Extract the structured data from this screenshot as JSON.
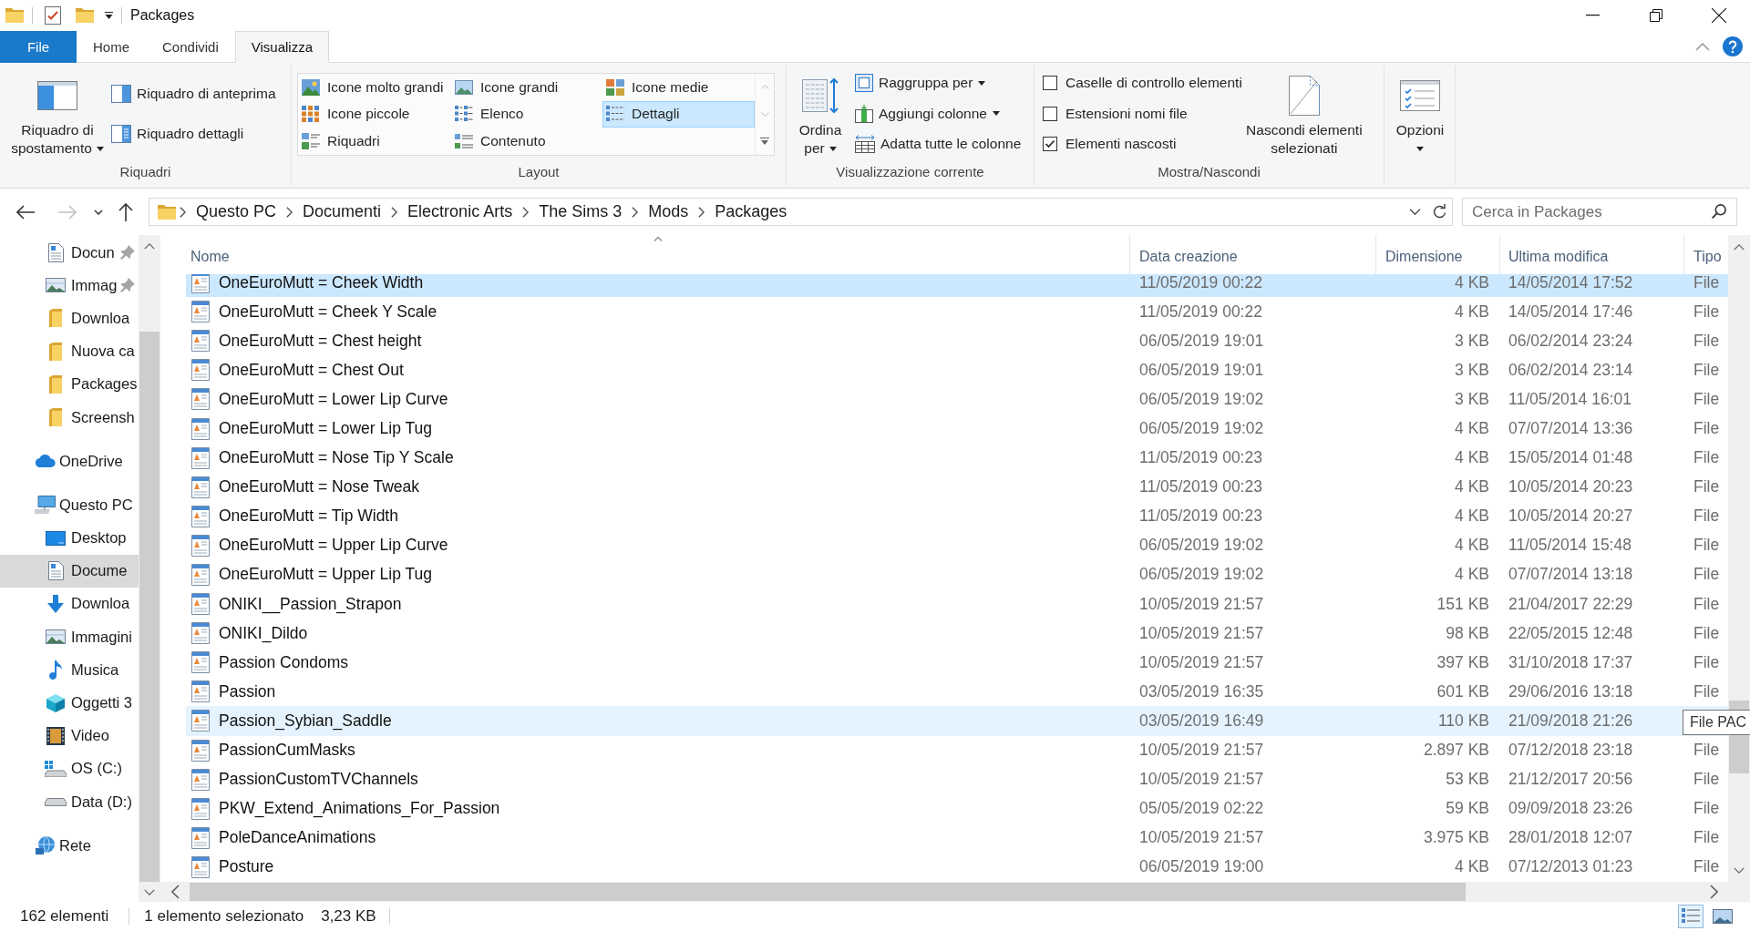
{
  "window": {
    "title": "Packages"
  },
  "ribbon": {
    "tabs": [
      {
        "label": "File",
        "kind": "file",
        "selected": false
      },
      {
        "label": "Home",
        "kind": "tab",
        "selected": false
      },
      {
        "label": "Condividi",
        "kind": "tab",
        "selected": false
      },
      {
        "label": "Visualizza",
        "kind": "tab",
        "selected": true
      }
    ],
    "groups": [
      {
        "kind": "panes",
        "label": "Riquadri",
        "large": {
          "lines": [
            "Riquadro di",
            "spostamento"
          ],
          "dropdown": true
        },
        "items": [
          {
            "kind": "preview",
            "label": "Riquadro di anteprima"
          },
          {
            "kind": "details",
            "label": "Riquadro dettagli"
          }
        ]
      },
      {
        "kind": "gallery",
        "label": "Layout",
        "items": [
          {
            "kind": "huge",
            "label": "Icone molto grandi",
            "selected": false
          },
          {
            "kind": "large",
            "label": "Icone grandi",
            "selected": false
          },
          {
            "kind": "medium",
            "label": "Icone medie",
            "selected": false
          },
          {
            "kind": "small",
            "label": "Icone piccole",
            "selected": false
          },
          {
            "kind": "list",
            "label": "Elenco",
            "selected": false
          },
          {
            "kind": "details",
            "label": "Dettagli",
            "selected": true
          },
          {
            "kind": "tiles",
            "label": "Riquadri",
            "selected": false
          },
          {
            "kind": "content",
            "label": "Contenuto",
            "selected": false
          }
        ]
      },
      {
        "kind": "view",
        "label": "Visualizzazione corrente",
        "large": {
          "lines": [
            "Ordina",
            "per"
          ],
          "dropdown": true
        },
        "items": [
          {
            "kind": "group",
            "label": "Raggruppa per",
            "dropdown": true
          },
          {
            "kind": "columns",
            "label": "Aggiungi colonne",
            "dropdown": true
          },
          {
            "kind": "fit",
            "label": "Adatta tutte le colonne",
            "dropdown": false
          }
        ]
      },
      {
        "kind": "showhide",
        "label": "Mostra/Nascondi",
        "checkboxes": [
          {
            "label": "Caselle di controllo elementi",
            "checked": false
          },
          {
            "label": "Estensioni nomi file",
            "checked": false
          },
          {
            "label": "Elementi nascosti",
            "checked": true
          }
        ],
        "large": {
          "lines": [
            "Nascondi elementi",
            "selezionati"
          ],
          "dropdown": false
        }
      },
      {
        "kind": "options",
        "large": {
          "lines": [
            "Opzioni"
          ],
          "dropdown": true
        }
      }
    ]
  },
  "address_bar": {
    "nav_buttons": [
      {
        "kind": "back",
        "disabled": false
      },
      {
        "kind": "forward",
        "disabled": true
      },
      {
        "kind": "recent",
        "disabled": false
      },
      {
        "kind": "up",
        "disabled": false
      }
    ],
    "crumbs": [
      "Questo PC",
      "Documenti",
      "Electronic Arts",
      "The Sims 3",
      "Mods",
      "Packages"
    ],
    "search": {
      "placeholder": "Cerca in Packages"
    }
  },
  "navigation": {
    "tree": [
      {
        "children": [
          {
            "kind": "document",
            "label": "Docun",
            "pinned": true,
            "selected": false
          },
          {
            "kind": "pictures",
            "label": "Immag",
            "pinned": true,
            "selected": false
          },
          {
            "kind": "folder",
            "label": "Downloa",
            "pinned": false,
            "selected": false
          },
          {
            "kind": "folder",
            "label": "Nuova ca",
            "pinned": false,
            "selected": false
          },
          {
            "kind": "folder",
            "label": "Packages",
            "pinned": false,
            "selected": false
          },
          {
            "kind": "folder",
            "label": "Screensh",
            "pinned": false,
            "selected": false
          }
        ]
      },
      {
        "kind": "cloud",
        "label": "OneDrive",
        "selected": false
      },
      {
        "kind": "computer",
        "label": "Questo PC",
        "selected": false,
        "children": [
          {
            "kind": "desktop",
            "label": "Desktop",
            "selected": false
          },
          {
            "kind": "document",
            "label": "Docume",
            "selected": true
          },
          {
            "kind": "downloads",
            "label": "Downloa",
            "selected": false
          },
          {
            "kind": "pictures",
            "label": "Immagini",
            "selected": false
          },
          {
            "kind": "music",
            "label": "Musica",
            "selected": false
          },
          {
            "kind": "objects",
            "label": "Oggetti 3",
            "selected": false
          },
          {
            "kind": "video",
            "label": "Video",
            "selected": false
          },
          {
            "kind": "sysdrive",
            "label": "OS (C:)",
            "selected": false
          },
          {
            "kind": "drive",
            "label": "Data (D:)",
            "selected": false
          }
        ]
      },
      {
        "kind": "network",
        "label": "Rete",
        "selected": false
      }
    ]
  },
  "file_list": {
    "columns": [
      {
        "label": "Nome",
        "sorted": true
      },
      {
        "label": "Data creazione",
        "sorted": false
      },
      {
        "label": "Dimensione",
        "sorted": false
      },
      {
        "label": "Ultima modifica",
        "sorted": false
      },
      {
        "label": "Tipo",
        "sorted": false
      }
    ],
    "rows": [
      {
        "cells": [
          "OneEuroMutt = Cheek Width",
          "11/05/2019 00:22",
          "4 KB",
          "14/05/2014 17:52",
          "File"
        ],
        "selected": true,
        "hovered": false
      },
      {
        "cells": [
          "OneEuroMutt = Cheek Y Scale",
          "11/05/2019 00:22",
          "4 KB",
          "14/05/2014 17:46",
          "File"
        ],
        "selected": false,
        "hovered": false
      },
      {
        "cells": [
          "OneEuroMutt = Chest height",
          "06/05/2019 19:01",
          "3 KB",
          "06/02/2014 23:24",
          "File"
        ],
        "selected": false,
        "hovered": false
      },
      {
        "cells": [
          "OneEuroMutt = Chest Out",
          "06/05/2019 19:01",
          "3 KB",
          "06/02/2014 23:14",
          "File"
        ],
        "selected": false,
        "hovered": false
      },
      {
        "cells": [
          "OneEuroMutt = Lower Lip Curve",
          "06/05/2019 19:02",
          "3 KB",
          "11/05/2014 16:01",
          "File"
        ],
        "selected": false,
        "hovered": false
      },
      {
        "cells": [
          "OneEuroMutt = Lower Lip Tug",
          "06/05/2019 19:02",
          "4 KB",
          "07/07/2014 13:36",
          "File"
        ],
        "selected": false,
        "hovered": false
      },
      {
        "cells": [
          "OneEuroMutt = Nose Tip Y Scale",
          "11/05/2019 00:23",
          "4 KB",
          "15/05/2014 01:48",
          "File"
        ],
        "selected": false,
        "hovered": false
      },
      {
        "cells": [
          "OneEuroMutt = Nose Tweak",
          "11/05/2019 00:23",
          "4 KB",
          "10/05/2014 20:23",
          "File"
        ],
        "selected": false,
        "hovered": false
      },
      {
        "cells": [
          "OneEuroMutt = Tip Width",
          "11/05/2019 00:23",
          "4 KB",
          "10/05/2014 20:27",
          "File"
        ],
        "selected": false,
        "hovered": false
      },
      {
        "cells": [
          "OneEuroMutt = Upper Lip Curve",
          "06/05/2019 19:02",
          "4 KB",
          "11/05/2014 15:48",
          "File"
        ],
        "selected": false,
        "hovered": false
      },
      {
        "cells": [
          "OneEuroMutt = Upper Lip Tug",
          "06/05/2019 19:02",
          "4 KB",
          "07/07/2014 13:18",
          "File"
        ],
        "selected": false,
        "hovered": false
      },
      {
        "cells": [
          "ONIKI__Passion_Strapon",
          "10/05/2019 21:57",
          "151 KB",
          "21/04/2017 22:29",
          "File"
        ],
        "selected": false,
        "hovered": false
      },
      {
        "cells": [
          "ONIKI_Dildo",
          "10/05/2019 21:57",
          "98 KB",
          "22/05/2015 12:48",
          "File"
        ],
        "selected": false,
        "hovered": false
      },
      {
        "cells": [
          "Passion Condoms",
          "10/05/2019 21:57",
          "397 KB",
          "31/10/2018 17:37",
          "File"
        ],
        "selected": false,
        "hovered": false
      },
      {
        "cells": [
          "Passion",
          "03/05/2019 16:35",
          "601 KB",
          "29/06/2016 13:18",
          "File"
        ],
        "selected": false,
        "hovered": false
      },
      {
        "cells": [
          "Passion_Sybian_Saddle",
          "03/05/2019 16:49",
          "110 KB",
          "21/09/2018 21:26"
        ],
        "selected": false,
        "hovered": true,
        "tooltip": "File PAC"
      },
      {
        "cells": [
          "PassionCumMasks",
          "10/05/2019 21:57",
          "2.897 KB",
          "07/12/2018 23:18",
          "File"
        ],
        "selected": false,
        "hovered": false
      },
      {
        "cells": [
          "PassionCustomTVChannels",
          "10/05/2019 21:57",
          "53 KB",
          "21/12/2017 20:56",
          "File"
        ],
        "selected": false,
        "hovered": false
      },
      {
        "cells": [
          "PKW_Extend_Animations_For_Passion",
          "05/05/2019 02:22",
          "59 KB",
          "09/09/2018 23:26",
          "File"
        ],
        "selected": false,
        "hovered": false
      },
      {
        "cells": [
          "PoleDanceAnimations",
          "10/05/2019 21:57",
          "3.975 KB",
          "28/01/2018 12:07",
          "File"
        ],
        "selected": false,
        "hovered": false
      },
      {
        "cells": [
          "Posture",
          "06/05/2019 19:00",
          "4 KB",
          "07/12/2013 01:23",
          "File"
        ],
        "selected": false,
        "hovered": false
      }
    ]
  },
  "status_bar": {
    "item_count": "162 elementi",
    "selection": "1 elemento selezionato",
    "selection_size": "3,23 KB",
    "view_toggles": [
      {
        "kind": "details",
        "selected": true
      },
      {
        "kind": "thumbnails",
        "selected": false
      }
    ]
  }
}
